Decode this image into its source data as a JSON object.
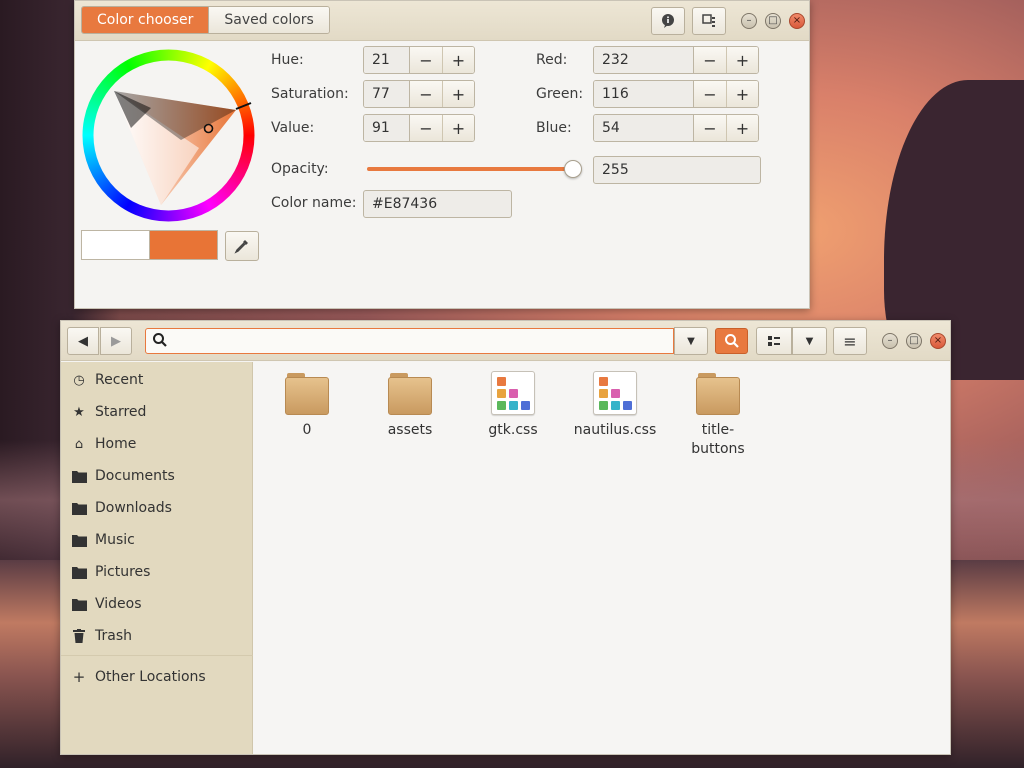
{
  "color_chooser": {
    "tabs": [
      "Color chooser",
      "Saved colors"
    ],
    "fields": {
      "hue": {
        "label": "Hue:",
        "value": "21"
      },
      "saturation": {
        "label": "Saturation:",
        "value": "77"
      },
      "value": {
        "label": "Value:",
        "value": "91"
      },
      "red": {
        "label": "Red:",
        "value": "232"
      },
      "green": {
        "label": "Green:",
        "value": "116"
      },
      "blue": {
        "label": "Blue:",
        "value": "54"
      }
    },
    "opacity": {
      "label": "Opacity:",
      "value": "255",
      "level": 1.0
    },
    "color_name": {
      "label": "Color name:",
      "value": "#E87436"
    },
    "minus": "−",
    "plus": "+",
    "current_color": "#E87436",
    "previous_color": "#FFFFFF"
  },
  "file_manager": {
    "search": {
      "placeholder": "",
      "value": ""
    },
    "sidebar": [
      {
        "icon": "clock-icon",
        "label": "Recent"
      },
      {
        "icon": "star-icon",
        "label": "Starred"
      },
      {
        "icon": "home-icon",
        "label": "Home"
      },
      {
        "icon": "folder-icon",
        "label": "Documents"
      },
      {
        "icon": "folder-icon",
        "label": "Downloads"
      },
      {
        "icon": "folder-icon",
        "label": "Music"
      },
      {
        "icon": "folder-icon",
        "label": "Pictures"
      },
      {
        "icon": "folder-icon",
        "label": "Videos"
      },
      {
        "icon": "trash-icon",
        "label": "Trash"
      }
    ],
    "other_locations": {
      "icon": "plus-icon",
      "label": "Other Locations"
    },
    "files": [
      {
        "name": "0",
        "kind": "folder"
      },
      {
        "name": "assets",
        "kind": "folder"
      },
      {
        "name": "gtk.css",
        "kind": "css"
      },
      {
        "name": "nautilus.css",
        "kind": "css"
      },
      {
        "name": "title-buttons",
        "kind": "folder"
      }
    ]
  },
  "colors": {
    "accent": "#E8793F",
    "sidebar": "#E2D9BF",
    "header": "#E2DAC6"
  }
}
